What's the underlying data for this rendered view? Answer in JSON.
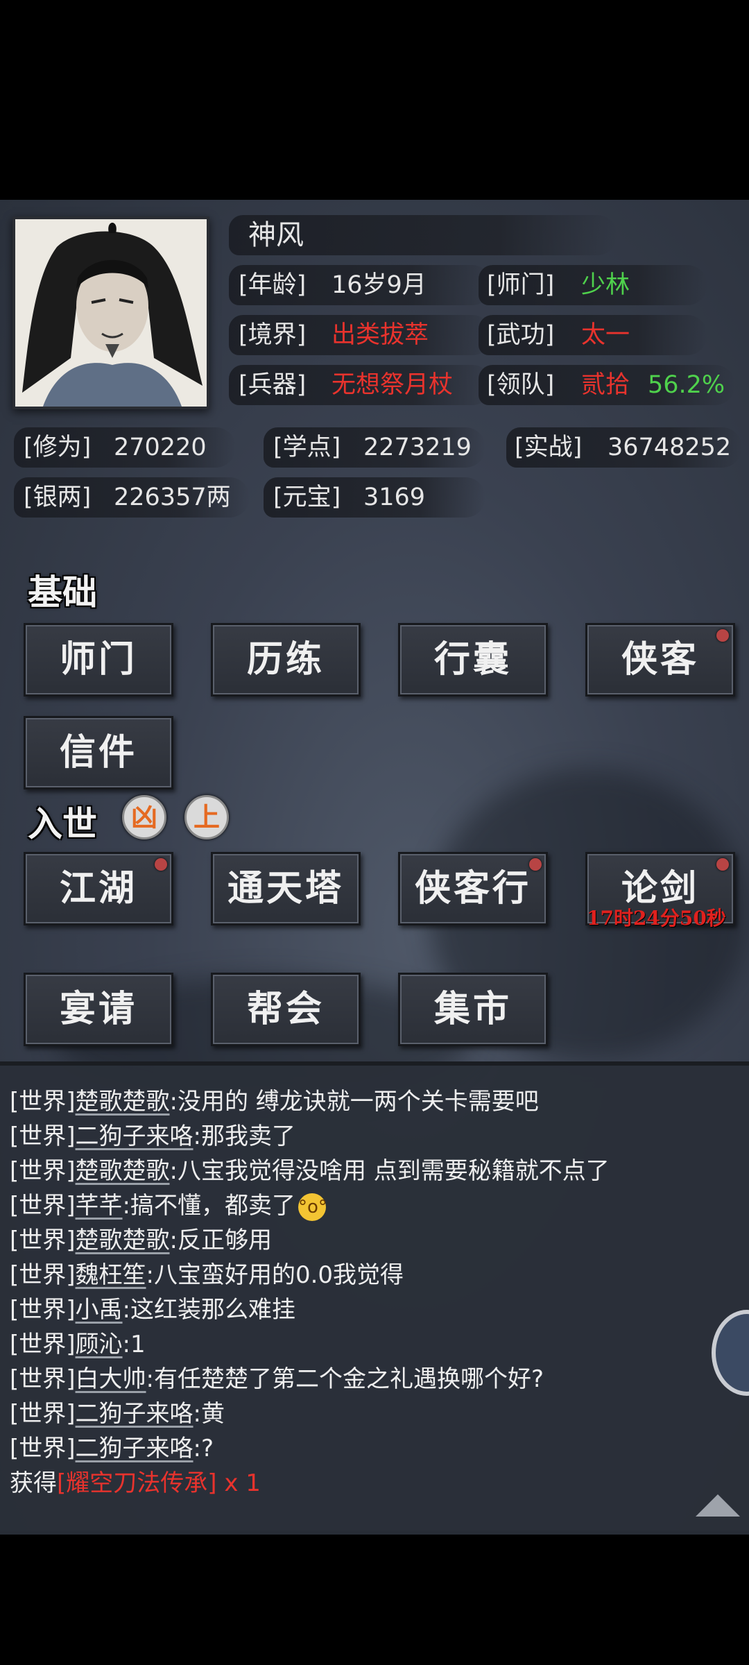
{
  "profile": {
    "name": "神风",
    "age_label": "[年龄]",
    "age": "16岁9月",
    "sect_label": "[师门]",
    "sect": "少林",
    "realm_label": "[境界]",
    "realm": "出类拔萃",
    "skill_label": "[武功]",
    "skill": "太一",
    "weapon_label": "[兵器]",
    "weapon": "无想祭月杖",
    "team_label": "[领队]",
    "team": "贰拾",
    "team_pct": "56.2%"
  },
  "stats": {
    "cultivation_label": "[修为]",
    "cultivation": "270220",
    "study_label": "[学点]",
    "study": "2273219",
    "combat_label": "[实战]",
    "combat": "36748252",
    "silver_label": "[银两]",
    "silver": "226357两",
    "gold_label": "[元宝]",
    "gold": "3169"
  },
  "sections": {
    "basic": "基础",
    "world": "入世"
  },
  "basic_buttons": {
    "shimen": "师门",
    "lilian": "历练",
    "xingnang": "行囊",
    "xiake": "侠客",
    "xinjian": "信件"
  },
  "world_icons": {
    "left": "凶",
    "right": "上"
  },
  "world_buttons": {
    "jianghu": "江湖",
    "tongtianta": "通天塔",
    "xiakexing": "侠客行",
    "lunjian": "论剑",
    "lunjian_timer": "17时24分50秒",
    "yanqing": "宴请",
    "banghui": "帮会",
    "jishi": "集市"
  },
  "chat": {
    "lines": [
      {
        "channel": "[世界]",
        "name": "楚歌楚歌",
        "text": ":没用的  缚龙诀就一两个关卡需要吧"
      },
      {
        "channel": "[世界]",
        "name": "二狗子来咯",
        "text": ":那我卖了"
      },
      {
        "channel": "[世界]",
        "name": "楚歌楚歌",
        "text": ":八宝我觉得没啥用  点到需要秘籍就不点了"
      },
      {
        "channel": "[世界]",
        "name": "芊芊",
        "text": ":搞不懂，都卖了"
      },
      {
        "channel": "[世界]",
        "name": "楚歌楚歌",
        "text": ":反正够用"
      },
      {
        "channel": "[世界]",
        "name": "魏枉笙",
        "text": ":八宝蛮好用的0.0我觉得"
      },
      {
        "channel": "[世界]",
        "name": "小禹",
        "text": ":这红装那么难挂"
      },
      {
        "channel": "[世界]",
        "name": "顾沁",
        "text": ":1"
      },
      {
        "channel": "[世界]",
        "name": "白大帅",
        "text": ":有任楚楚了第二个金之礼遇换哪个好?"
      },
      {
        "channel": "[世界]",
        "name": "二狗子来咯",
        "text": ":黄"
      },
      {
        "channel": "[世界]",
        "name": "二狗子来咯",
        "text": ":?"
      }
    ],
    "obtain_prefix": "获得",
    "obtain_item": "[耀空刀法传承]",
    "obtain_count": " x 1"
  },
  "colors": {
    "green": "#4fd14c",
    "red": "#e8332d",
    "text": "#e6e6e6"
  }
}
